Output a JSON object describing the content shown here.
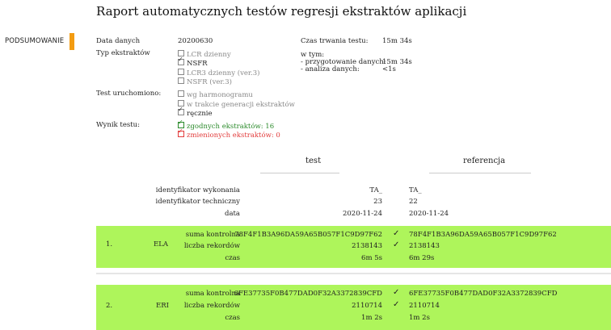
{
  "title": "Raport automatycznych testów regresji ekstraktów aplikacji",
  "nav": {
    "summary_label": "PODSUMOWANIE"
  },
  "info": {
    "data_label": "Data danych",
    "data_value": "20200630",
    "typ_label": "Typ ekstraktów",
    "typ_options": [
      {
        "label": "LCR dzienny",
        "checked": false
      },
      {
        "label": "NSFR",
        "checked": true
      },
      {
        "label": "LCR3 dzienny (ver.3)",
        "checked": false
      },
      {
        "label": "NSFR (ver.3)",
        "checked": false
      }
    ],
    "uruch_label": "Test uruchomiono:",
    "uruch_options": [
      {
        "label": "wg harmonogramu",
        "checked": false
      },
      {
        "label": "w trakcie generacji ekstraktów",
        "checked": false
      },
      {
        "label": "ręcznie",
        "checked": true
      }
    ],
    "wynik_label": "Wynik testu:",
    "wynik_ok": "zgodnych ekstraktów: 16",
    "wynik_changed": "zmienionych ekstraktów: 0",
    "czas_label": "Czas trwania testu:",
    "czas_value": "15m 34s",
    "wtym_label": "w tym:",
    "przyg_label": "- przygotowanie danych:",
    "przyg_value": "15m 34s",
    "analiza_label": "- analiza danych:",
    "analiza_value": "<1s"
  },
  "compare": {
    "test_head": "test",
    "ref_head": "referencja",
    "rows": [
      {
        "label": "identyfikator wykonania",
        "test": "TA_",
        "ref": "TA_"
      },
      {
        "label": "identyfikator techniczny",
        "test": "23",
        "ref": "22"
      },
      {
        "label": "data",
        "test": "2020-11-24",
        "ref": "2020-11-24"
      }
    ]
  },
  "extracts": [
    {
      "num": "1.",
      "name": "ELA",
      "checksum_label": "suma kontrolna",
      "checksum_test": "78F4F1B3A96DA59A65B057F1C9D97F62",
      "checksum_ref": "78F4F1B3A96DA59A65B057F1C9D97F62",
      "count_label": "liczba rekordów",
      "count_test": "2138143",
      "count_ref": "2138143",
      "time_label": "czas",
      "time_test": "6m 5s",
      "time_ref": "6m 29s",
      "check": "✓"
    },
    {
      "num": "2.",
      "name": "ERI",
      "checksum_label": "suma kontrolna",
      "checksum_test": "6FE37735F0B477DAD0F32A3372839CFD",
      "checksum_ref": "6FE37735F0B477DAD0F32A3372839CFD",
      "count_label": "liczba rekordów",
      "count_test": "2110714",
      "count_ref": "2110714",
      "time_label": "czas",
      "time_test": "1m 2s",
      "time_ref": "1m 2s",
      "check": "✓"
    }
  ],
  "colors": {
    "accent": "#f39c12",
    "band": "#aef55b",
    "ok": "#2a8a2a",
    "changed": "#e23b3b"
  }
}
